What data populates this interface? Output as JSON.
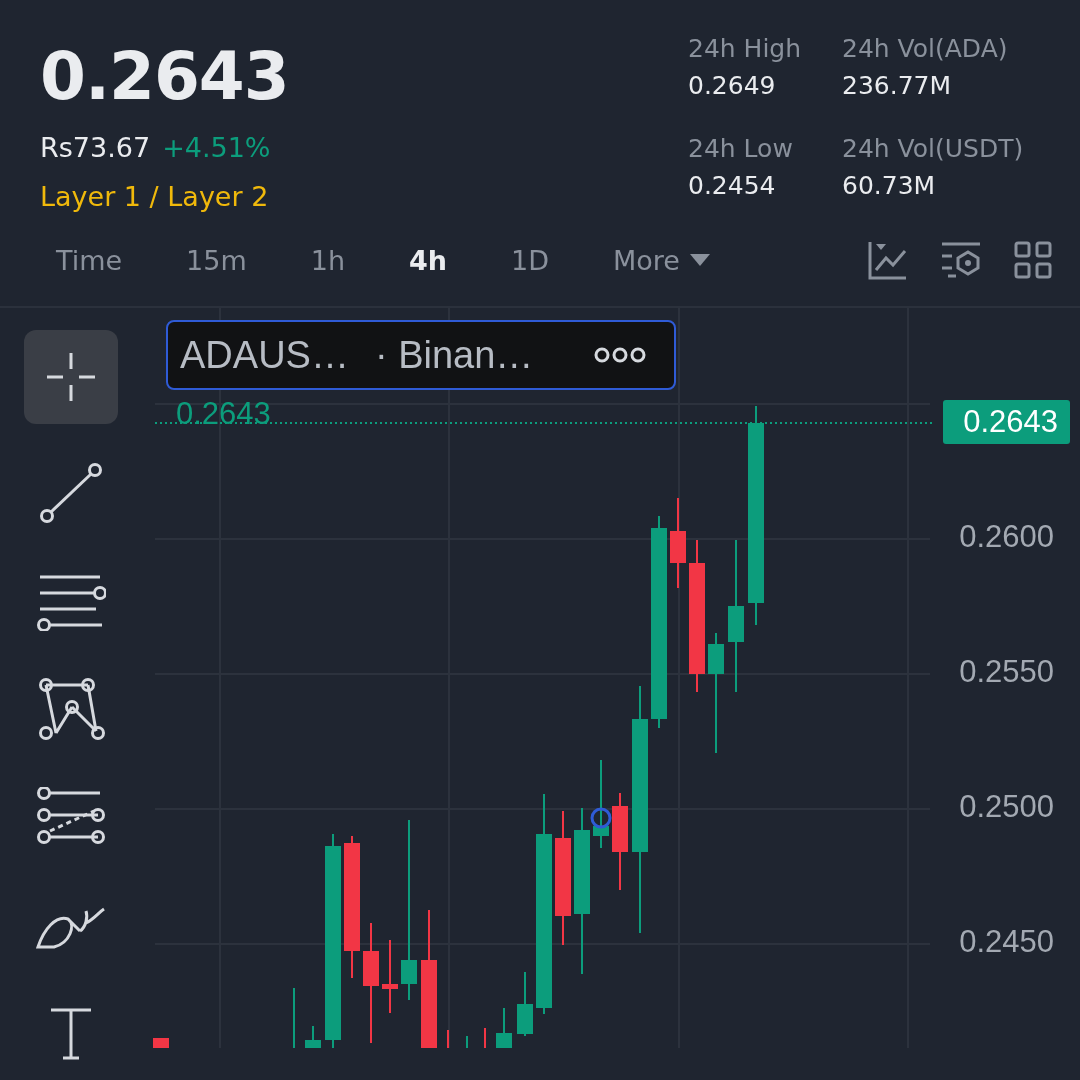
{
  "price": "0.2643",
  "fiat": "Rs73.67",
  "change": "+4.51%",
  "category": "Layer 1 / Layer 2",
  "stats": [
    {
      "label": "24h High",
      "value": "0.2649"
    },
    {
      "label": "24h Vol(ADA)",
      "value": "236.77M"
    },
    {
      "label": "24h Low",
      "value": "0.2454"
    },
    {
      "label": "24h Vol(USDT)",
      "value": "60.73M"
    }
  ],
  "intervals": [
    {
      "label": "Time",
      "selected": false
    },
    {
      "label": "15m",
      "selected": false
    },
    {
      "label": "1h",
      "selected": false
    },
    {
      "label": "4h",
      "selected": true
    },
    {
      "label": "1D",
      "selected": false
    },
    {
      "label": "More",
      "selected": false,
      "kind": "dropdown"
    }
  ],
  "tools": [
    {
      "kind": "crosshair",
      "selected": true
    },
    {
      "kind": "trendline",
      "selected": false
    },
    {
      "kind": "hlines",
      "selected": false
    },
    {
      "kind": "pattern",
      "selected": false
    },
    {
      "kind": "fib",
      "selected": false
    },
    {
      "kind": "brush",
      "selected": false
    },
    {
      "kind": "text",
      "selected": false
    }
  ],
  "chart": {
    "symbol": "ADAUS…",
    "exchange": "· Binan…",
    "price_line_label": "0.2643",
    "current_price": "0.2643",
    "axis_labels": [
      "0.2600",
      "0.2550",
      "0.2500",
      "0.2450"
    ]
  }
}
